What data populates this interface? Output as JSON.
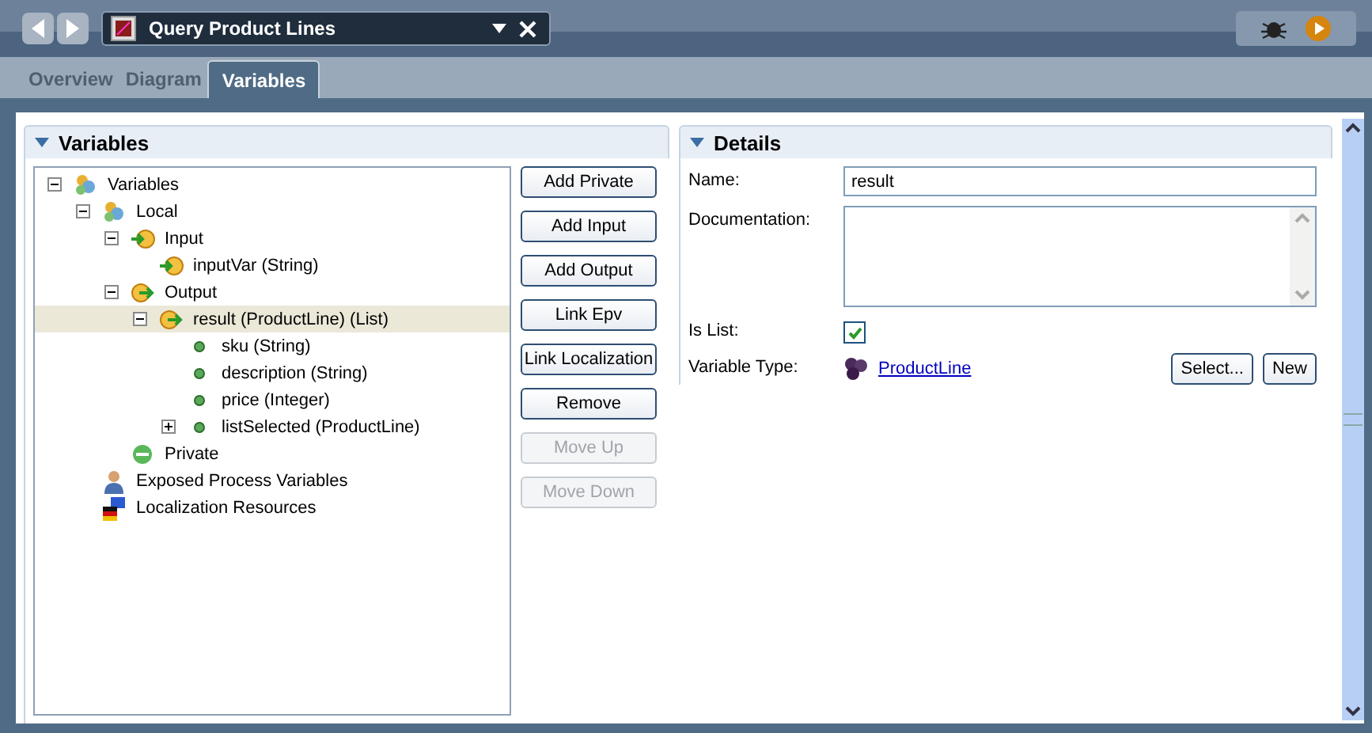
{
  "editor_tab": {
    "title": "Query Product Lines"
  },
  "tabs": [
    {
      "label": "Overview",
      "selected": false
    },
    {
      "label": "Diagram",
      "selected": false
    },
    {
      "label": "Variables",
      "selected": true
    }
  ],
  "variables_section": {
    "title": "Variables",
    "tree": [
      {
        "label": "Variables",
        "kind": "group",
        "expanded": true,
        "selected": false,
        "children": [
          {
            "label": "Local",
            "kind": "group",
            "expanded": true,
            "selected": false,
            "children": [
              {
                "label": "Input",
                "kind": "input",
                "expanded": true,
                "selected": false,
                "children": [
                  {
                    "label": "inputVar (String)",
                    "kind": "input",
                    "selected": false
                  }
                ]
              },
              {
                "label": "Output",
                "kind": "output",
                "expanded": true,
                "selected": false,
                "children": [
                  {
                    "label": "result (ProductLine) (List)",
                    "kind": "output",
                    "expanded": true,
                    "selected": true,
                    "children": [
                      {
                        "label": "sku (String)",
                        "kind": "field",
                        "selected": false
                      },
                      {
                        "label": "description (String)",
                        "kind": "field",
                        "selected": false
                      },
                      {
                        "label": "price (Integer)",
                        "kind": "field",
                        "selected": false
                      },
                      {
                        "label": "listSelected (ProductLine)",
                        "kind": "field",
                        "expanded": false,
                        "selected": false
                      }
                    ]
                  }
                ]
              },
              {
                "label": "Private",
                "kind": "private",
                "selected": false
              }
            ]
          },
          {
            "label": "Exposed Process Variables",
            "kind": "exposed",
            "selected": false
          },
          {
            "label": "Localization Resources",
            "kind": "localization",
            "selected": false
          }
        ]
      }
    ],
    "buttons": [
      {
        "label": "Add Private",
        "disabled": false
      },
      {
        "label": "Add Input",
        "disabled": false
      },
      {
        "label": "Add Output",
        "disabled": false
      },
      {
        "label": "Link Epv",
        "disabled": false
      },
      {
        "label": "Link Localization",
        "disabled": false
      },
      {
        "label": "Remove",
        "disabled": false
      },
      {
        "label": "Move Up",
        "disabled": true
      },
      {
        "label": "Move Down",
        "disabled": true
      }
    ]
  },
  "details_section": {
    "title": "Details",
    "name_label": "Name:",
    "name_value": "result",
    "documentation_label": "Documentation:",
    "is_list_label": "Is List:",
    "is_list_checked": true,
    "variable_type_label": "Variable Type:",
    "variable_type_link": "ProductLine",
    "buttons": [
      {
        "label": "Select..."
      },
      {
        "label": "New"
      }
    ]
  }
}
